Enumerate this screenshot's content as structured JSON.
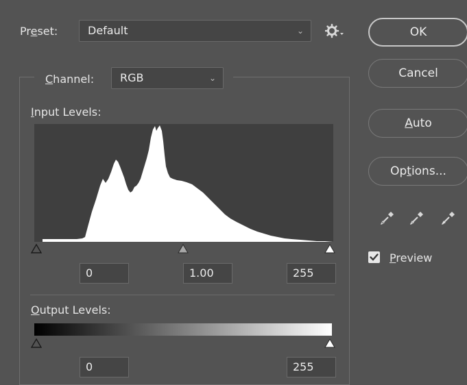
{
  "preset": {
    "label_pre": "Pr",
    "label_mnemonic": "e",
    "label_post": "set:",
    "value": "Default",
    "menu_icon": "gear-icon"
  },
  "channel": {
    "label_mnemonic": "C",
    "label_post": "hannel:",
    "value": "RGB"
  },
  "input_levels": {
    "label_mnemonic": "I",
    "label_post": "nput Levels:",
    "black": "0",
    "gamma": "1.00",
    "white": "255"
  },
  "output_levels": {
    "label_mnemonic": "O",
    "label_post": "utput Levels:",
    "black": "0",
    "white": "255"
  },
  "buttons": {
    "ok": "OK",
    "cancel": "Cancel",
    "auto_mnemonic": "A",
    "auto_post": "uto",
    "options_pre": "Op",
    "options_mnemonic": "t",
    "options_post": "ions..."
  },
  "preview": {
    "checked": true,
    "label_mnemonic": "P",
    "label_post": "review"
  },
  "colors": {
    "background": "#535353",
    "field": "#454545",
    "histogram_bg": "#3f3f3f",
    "histogram_fill": "#ffffff"
  }
}
